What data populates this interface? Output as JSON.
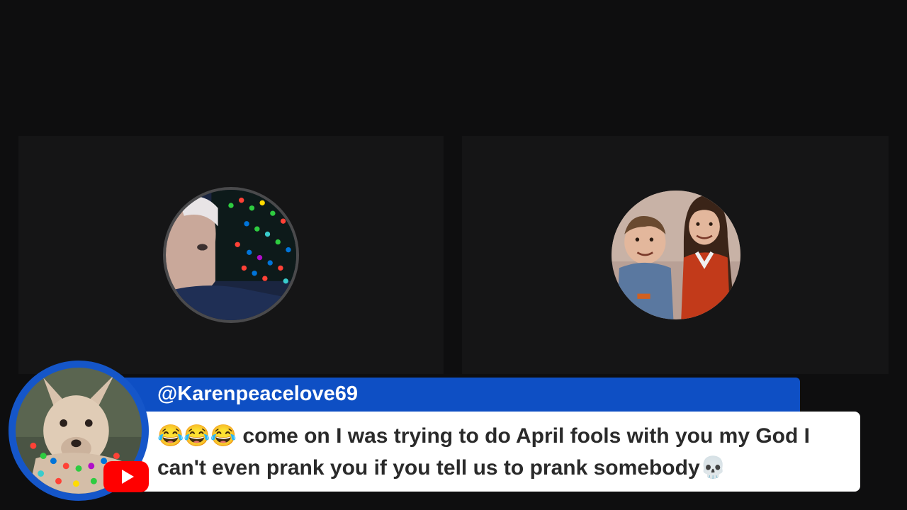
{
  "participants": [
    {
      "icon": "participant-avatar-holiday-lights"
    },
    {
      "icon": "participant-avatar-children-photo"
    }
  ],
  "comment": {
    "username": "@Karenpeacelove69",
    "message": "😂😂😂 come on I was trying to do April fools with you my God I can't even prank you if you tell us to prank somebody💀",
    "avatar_icon": "dog-with-lights-avatar",
    "badge_icon": "youtube-icon"
  },
  "colors": {
    "background": "#0e0e0f",
    "tile": "#151516",
    "name_bar": "#0e4fc4",
    "youtube_red": "#ff0000"
  }
}
